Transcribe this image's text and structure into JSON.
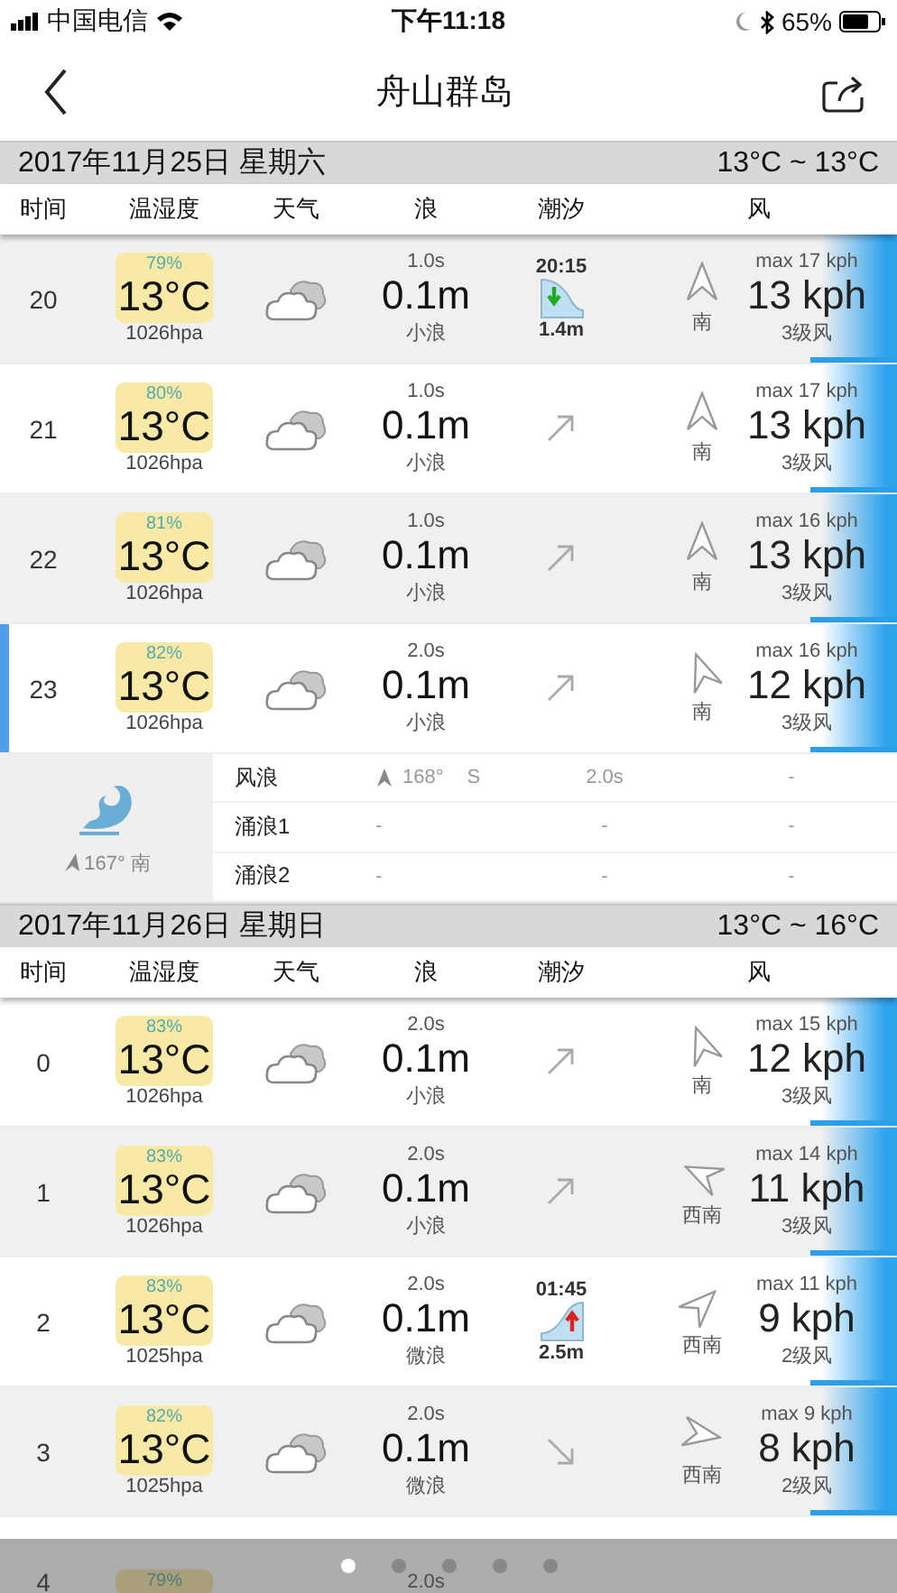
{
  "status_bar": {
    "carrier": "中国电信",
    "time": "下午11:18",
    "battery": "65%"
  },
  "nav": {
    "title": "舟山群岛"
  },
  "days": [
    {
      "date": "2017年11月25日 星期六",
      "range": "13°C ~ 13°C",
      "columns": [
        "时间",
        "温湿度",
        "天气",
        "浪",
        "潮汐",
        "风"
      ],
      "rows": [
        {
          "time": "20",
          "humidity": "79%",
          "temp": "13°C",
          "pressure": "1026hpa",
          "period": "1.0s",
          "height": "0.1m",
          "wave": "小浪",
          "tide": {
            "kind": "low",
            "time": "20:15",
            "height": "1.4m"
          },
          "wind": {
            "max": "max 17 kph",
            "speed": "13 kph",
            "dir": "南",
            "force": "3级风",
            "kind": "n"
          },
          "selected": false
        },
        {
          "time": "21",
          "humidity": "80%",
          "temp": "13°C",
          "pressure": "1026hpa",
          "period": "1.0s",
          "height": "0.1m",
          "wave": "小浪",
          "tide": {
            "kind": "rising"
          },
          "wind": {
            "max": "max 17 kph",
            "speed": "13 kph",
            "dir": "南",
            "force": "3级风",
            "kind": "n"
          },
          "selected": false
        },
        {
          "time": "22",
          "humidity": "81%",
          "temp": "13°C",
          "pressure": "1026hpa",
          "period": "1.0s",
          "height": "0.1m",
          "wave": "小浪",
          "tide": {
            "kind": "rising"
          },
          "wind": {
            "max": "max 16 kph",
            "speed": "13 kph",
            "dir": "南",
            "force": "3级风",
            "kind": "n"
          },
          "selected": false
        },
        {
          "time": "23",
          "humidity": "82%",
          "temp": "13°C",
          "pressure": "1026hpa",
          "period": "2.0s",
          "height": "0.1m",
          "wave": "小浪",
          "tide": {
            "kind": "rising"
          },
          "wind": {
            "max": "max 16 kph",
            "speed": "12 kph",
            "dir": "南",
            "force": "3级风",
            "kind": "nnw"
          },
          "selected": true
        }
      ],
      "detail": {
        "direction": "167° 南",
        "rows": [
          {
            "label": "风浪",
            "direction": "168°",
            "compass": "S",
            "period": "2.0s",
            "height": "-"
          },
          {
            "label": "涌浪1",
            "direction": "-",
            "period": "-",
            "height": "-"
          },
          {
            "label": "涌浪2",
            "direction": "-",
            "period": "-",
            "height": "-"
          }
        ]
      }
    },
    {
      "date": "2017年11月26日 星期日",
      "range": "13°C ~ 16°C",
      "columns": [
        "时间",
        "温湿度",
        "天气",
        "浪",
        "潮汐",
        "风"
      ],
      "rows": [
        {
          "time": "0",
          "humidity": "83%",
          "temp": "13°C",
          "pressure": "1026hpa",
          "period": "2.0s",
          "height": "0.1m",
          "wave": "小浪",
          "tide": {
            "kind": "rising"
          },
          "wind": {
            "max": "max 15 kph",
            "speed": "12 kph",
            "dir": "南",
            "force": "3级风",
            "kind": "nnw"
          },
          "selected": false
        },
        {
          "time": "1",
          "humidity": "83%",
          "temp": "13°C",
          "pressure": "1026hpa",
          "period": "2.0s",
          "height": "0.1m",
          "wave": "小浪",
          "tide": {
            "kind": "rising"
          },
          "wind": {
            "max": "max 14 kph",
            "speed": "11 kph",
            "dir": "西南",
            "force": "3级风",
            "kind": "wnw"
          },
          "selected": false
        },
        {
          "time": "2",
          "humidity": "83%",
          "temp": "13°C",
          "pressure": "1025hpa",
          "period": "2.0s",
          "height": "0.1m",
          "wave": "微浪",
          "tide": {
            "kind": "high",
            "time": "01:45",
            "height": "2.5m"
          },
          "wind": {
            "max": "max 11 kph",
            "speed": "9 kph",
            "dir": "西南",
            "force": "2级风",
            "kind": "ne"
          },
          "selected": false
        },
        {
          "time": "3",
          "humidity": "82%",
          "temp": "13°C",
          "pressure": "1025hpa",
          "period": "2.0s",
          "height": "0.1m",
          "wave": "微浪",
          "tide": {
            "kind": "falling"
          },
          "wind": {
            "max": "max 9 kph",
            "speed": "8 kph",
            "dir": "西南",
            "force": "2级风",
            "kind": "e"
          },
          "selected": false
        },
        {
          "time": "4",
          "humidity": "79%",
          "period": "2.0s",
          "selected": false
        }
      ]
    }
  ],
  "page_dots": [
    {
      "selected": true
    },
    {
      "selected": false
    },
    {
      "selected": false
    },
    {
      "selected": false
    },
    {
      "selected": false
    }
  ]
}
